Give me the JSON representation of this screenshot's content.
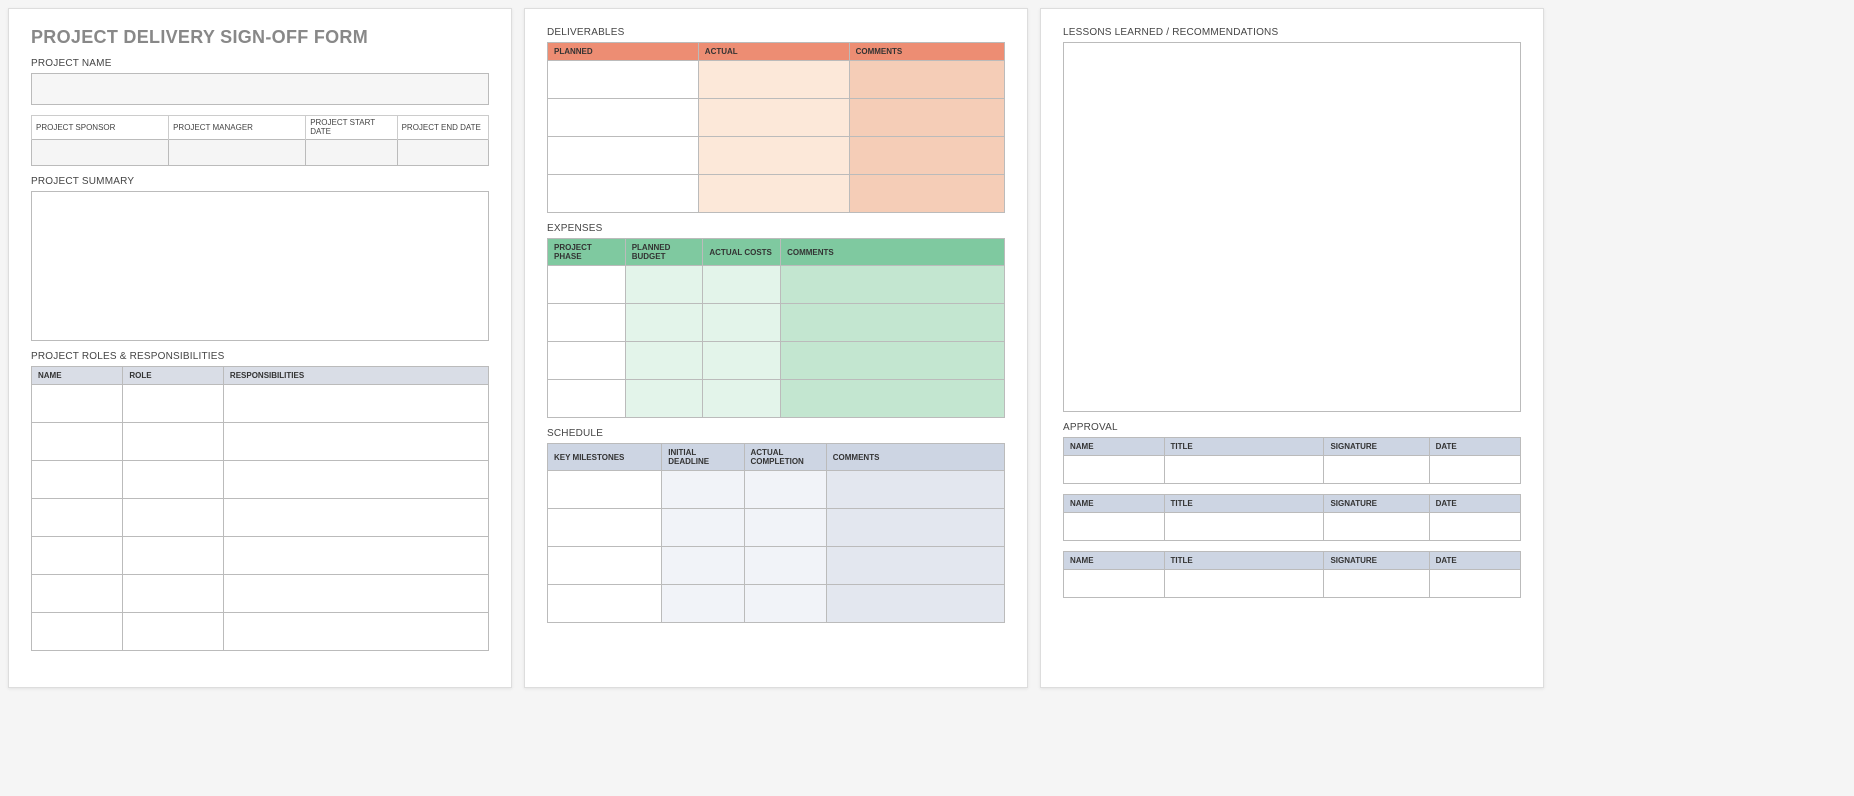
{
  "page1": {
    "form_title": "PROJECT DELIVERY SIGN-OFF FORM",
    "project_name_label": "PROJECT NAME",
    "meta": {
      "sponsor": "PROJECT SPONSOR",
      "manager": "PROJECT MANAGER",
      "start": "PROJECT START DATE",
      "end": "PROJECT END DATE"
    },
    "summary_label": "PROJECT SUMMARY",
    "roles_label": "PROJECT ROLES & RESPONSIBILITIES",
    "roles_headers": {
      "name": "NAME",
      "role": "ROLE",
      "resp": "RESPONSIBILITIES"
    }
  },
  "page2": {
    "deliverables_label": "DELIVERABLES",
    "deliv_headers": {
      "planned": "PLANNED",
      "actual": "ACTUAL",
      "comments": "COMMENTS"
    },
    "expenses_label": "EXPENSES",
    "exp_headers": {
      "phase": "PROJECT PHASE",
      "budget": "PLANNED BUDGET",
      "actual": "ACTUAL COSTS",
      "comments": "COMMENTS"
    },
    "schedule_label": "SCHEDULE",
    "sched_headers": {
      "milestones": "KEY MILESTONES",
      "initial": "INITIAL DEADLINE",
      "actual": "ACTUAL COMPLETION",
      "comments": "COMMENTS"
    }
  },
  "page3": {
    "lessons_label": "LESSONS LEARNED / RECOMMENDATIONS",
    "approval_label": "APPROVAL",
    "approval_headers": {
      "name": "NAME",
      "title": "TITLE",
      "signature": "SIGNATURE",
      "date": "DATE"
    }
  }
}
